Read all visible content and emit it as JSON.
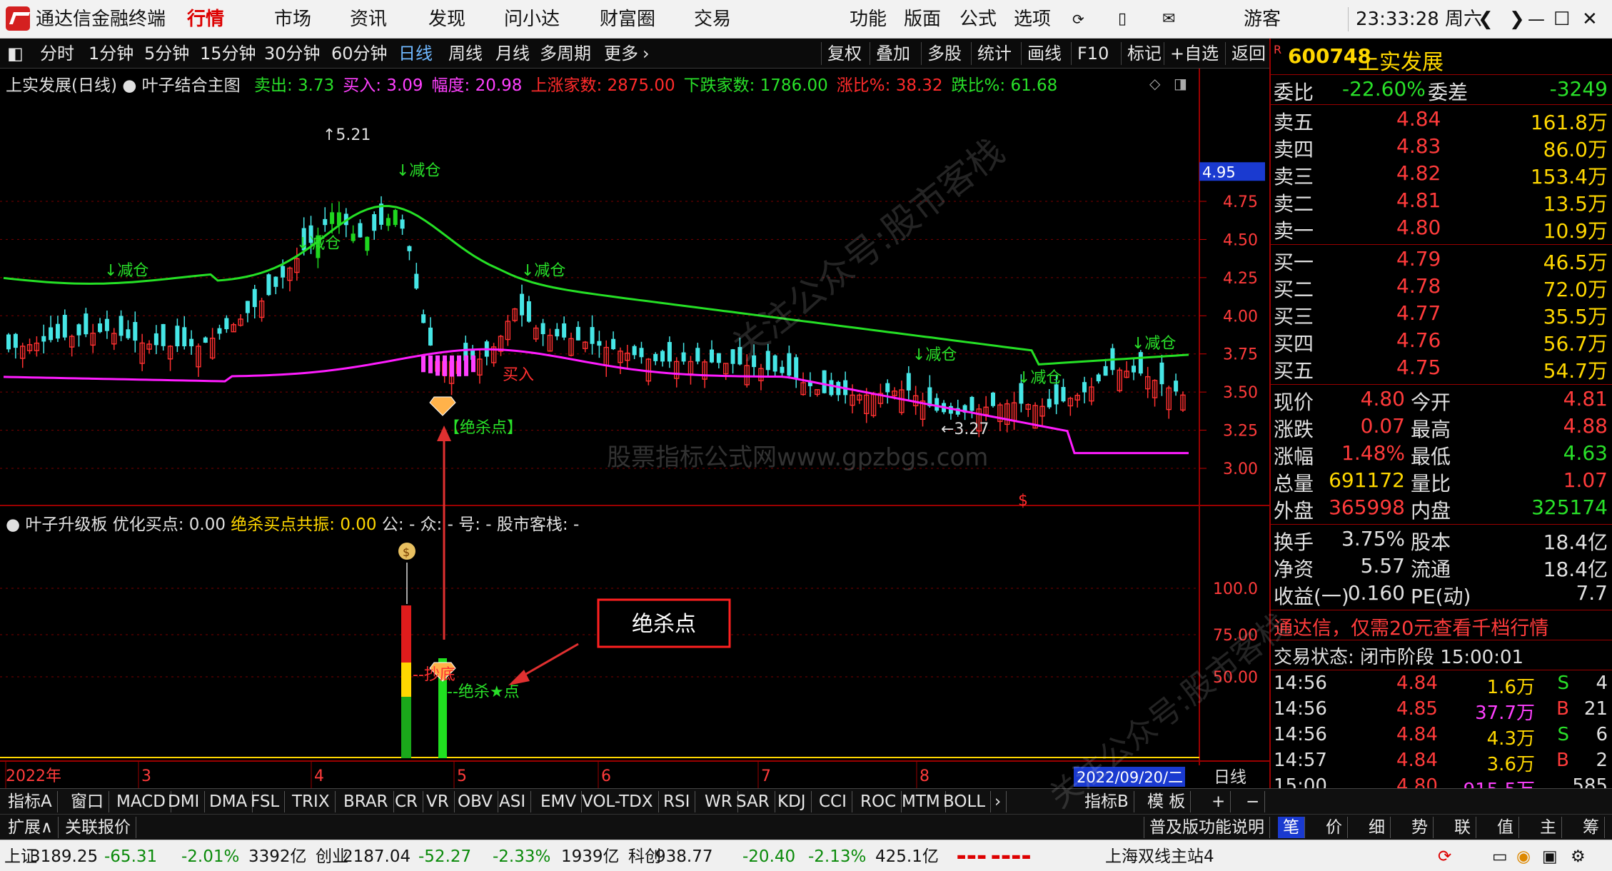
{
  "titlebar": {
    "app_name": "通达信金融终端",
    "nav": [
      "行情",
      "市场",
      "资讯",
      "发现",
      "问小达",
      "财富圈",
      "交易"
    ],
    "menu": [
      "功能",
      "版面",
      "公式",
      "选项"
    ],
    "user": "游客",
    "clock": "23:33:28 周六"
  },
  "periods": {
    "items": [
      "分时",
      "1分钟",
      "5分钟",
      "15分钟",
      "30分钟",
      "60分钟",
      "日线",
      "周线",
      "月线",
      "多周期",
      "更多"
    ],
    "active": "日线",
    "right": [
      "复权",
      "叠加",
      "多股",
      "统计",
      "画线",
      "F10",
      "标记",
      "+自选",
      "返回"
    ]
  },
  "main_chart": {
    "stock_title": "上实发展(日线)",
    "formula": "叶子结合主图",
    "stats": [
      {
        "label": "卖出: 3.73",
        "color": "#29e029"
      },
      {
        "label": "买入: 3.09",
        "color": "#ff40ff"
      },
      {
        "label": "幅度: 20.98",
        "color": "#ff40ff"
      },
      {
        "label": "上涨家数: 2875.00",
        "color": "#ff2b2b"
      },
      {
        "label": "下跌家数: 1786.00",
        "color": "#29e029"
      },
      {
        "label": "涨比%: 38.32",
        "color": "#ff2b2b"
      },
      {
        "label": "跌比%: 61.68",
        "color": "#29e029"
      }
    ],
    "price_ticks": [
      "4.75",
      "4.50",
      "4.25",
      "4.00",
      "3.75",
      "3.50",
      "3.25",
      "3.00"
    ],
    "current_price_tag": "4.95",
    "annotations": {
      "high": "5.21",
      "low": "3.27",
      "reduce": "减仓",
      "buy": "买入",
      "kill": "【绝杀点】",
      "dollar": "$"
    },
    "watermark_url": "股票指标公式网www.gpzbgs.com",
    "watermark_diag": "关注公众号:股市客栈"
  },
  "sub_chart": {
    "title": "叶子升级板",
    "optimize": "优化买点: 0.00",
    "kill_resonance": "绝杀买点共振: 0.00",
    "tail": "公: -  众: -  号: -  股市客栈: -",
    "ticks": [
      "100.0",
      "75.00",
      "50.00"
    ],
    "label_kill_star": "--绝杀★点",
    "label_dip": "--抄底",
    "callout": "绝杀点"
  },
  "timeline": {
    "labels": [
      "2022年",
      "3",
      "4",
      "5",
      "6",
      "7",
      "8"
    ],
    "date_box": "2022/09/20/二",
    "period": "日线"
  },
  "indicator_tabs": [
    "指标A",
    "窗口",
    "MACD",
    "DMI",
    "DMA",
    "FSL",
    "TRIX",
    "BRAR",
    "CR",
    "VR",
    "OBV",
    "ASI",
    "EMV",
    "VOL-TDX",
    "RSI",
    "WR",
    "SAR",
    "KDJ",
    "CCI",
    "ROC",
    "MTM",
    "BOLL"
  ],
  "indicator_right": [
    "指标B",
    "模 板",
    "+",
    "−"
  ],
  "bottom_left": [
    "扩展∧",
    "关联报价"
  ],
  "bottom_right_label": "普及版功能说明",
  "rp_tabs": [
    "笔",
    "价",
    "细",
    "势",
    "联",
    "值",
    "主",
    "筹"
  ],
  "quote": {
    "code": "600748",
    "name": "上实发展",
    "weibi_label": "委比",
    "weibi": "-22.60%",
    "weicha_label": "委差",
    "weicha": "-3249",
    "sells": [
      {
        "label": "卖五",
        "price": "4.84",
        "vol": "161.8万"
      },
      {
        "label": "卖四",
        "price": "4.83",
        "vol": "86.0万"
      },
      {
        "label": "卖三",
        "price": "4.82",
        "vol": "153.4万"
      },
      {
        "label": "卖二",
        "price": "4.81",
        "vol": "13.5万"
      },
      {
        "label": "卖一",
        "price": "4.80",
        "vol": "10.9万"
      }
    ],
    "buys": [
      {
        "label": "买一",
        "price": "4.79",
        "vol": "46.5万"
      },
      {
        "label": "买二",
        "price": "4.78",
        "vol": "72.0万"
      },
      {
        "label": "买三",
        "price": "4.77",
        "vol": "35.5万"
      },
      {
        "label": "买四",
        "price": "4.76",
        "vol": "56.7万"
      },
      {
        "label": "买五",
        "price": "4.75",
        "vol": "54.7万"
      }
    ],
    "stats_left": [
      {
        "label": "现价",
        "value": "4.80",
        "cls": "rp-red"
      },
      {
        "label": "涨跌",
        "value": "0.07",
        "cls": "rp-red"
      },
      {
        "label": "涨幅",
        "value": "1.48%",
        "cls": "rp-red"
      },
      {
        "label": "总量",
        "value": "691172",
        "cls": "rp-yellow"
      },
      {
        "label": "外盘",
        "value": "365998",
        "cls": "rp-red"
      }
    ],
    "stats_right": [
      {
        "label": "今开",
        "value": "4.81",
        "cls": "rp-red"
      },
      {
        "label": "最高",
        "value": "4.88",
        "cls": "rp-red"
      },
      {
        "label": "最低",
        "value": "4.63",
        "cls": "rp-green"
      },
      {
        "label": "量比",
        "value": "1.07",
        "cls": "rp-red"
      },
      {
        "label": "内盘",
        "value": "325174",
        "cls": "rp-green"
      }
    ],
    "stats2_left": [
      {
        "label": "换手",
        "value": "3.75%"
      },
      {
        "label": "净资",
        "value": "5.57"
      },
      {
        "label": "收益(一)",
        "value": "0.160"
      }
    ],
    "stats2_right": [
      {
        "label": "股本",
        "value": "18.4亿"
      },
      {
        "label": "流通",
        "value": "18.4亿"
      },
      {
        "label": "PE(动)",
        "value": "7.7"
      }
    ],
    "promo": "通达信，仅需20元查看千档行情",
    "trade_state": "交易状态: 闭市阶段 15:00:01",
    "ticks": [
      {
        "time": "14:56",
        "price": "4.84",
        "vol": "1.6万",
        "side": "S",
        "n": "4",
        "vcls": "rp-yellow"
      },
      {
        "time": "14:56",
        "price": "4.85",
        "vol": "37.7万",
        "side": "B",
        "n": "21",
        "vcls": "rp-mag"
      },
      {
        "time": "14:56",
        "price": "4.84",
        "vol": "4.3万",
        "side": "S",
        "n": "6",
        "vcls": "rp-yellow"
      },
      {
        "time": "14:57",
        "price": "4.84",
        "vol": "3.6万",
        "side": "B",
        "n": "2",
        "vcls": "rp-yellow"
      },
      {
        "time": "15:00",
        "price": "4.80",
        "vol": "915.5万",
        "side": "",
        "n": "585",
        "vcls": "rp-mag"
      }
    ]
  },
  "statusbar": {
    "sh_label": "上证",
    "sh": "3189.25",
    "sh_chg": "-65.31",
    "sh_pct": "-2.01%",
    "sh_amt": "3392亿",
    "cy_label": "创业",
    "cy": "2187.04",
    "cy_chg": "-52.27",
    "cy_pct": "-2.33%",
    "cy_amt": "1939亿",
    "kc_label": "科创",
    "kc": "938.77",
    "kc_chg": "-20.40",
    "kc_pct": "-2.13%",
    "kc_amt": "425.1亿",
    "server": "上海双线主站4"
  }
}
